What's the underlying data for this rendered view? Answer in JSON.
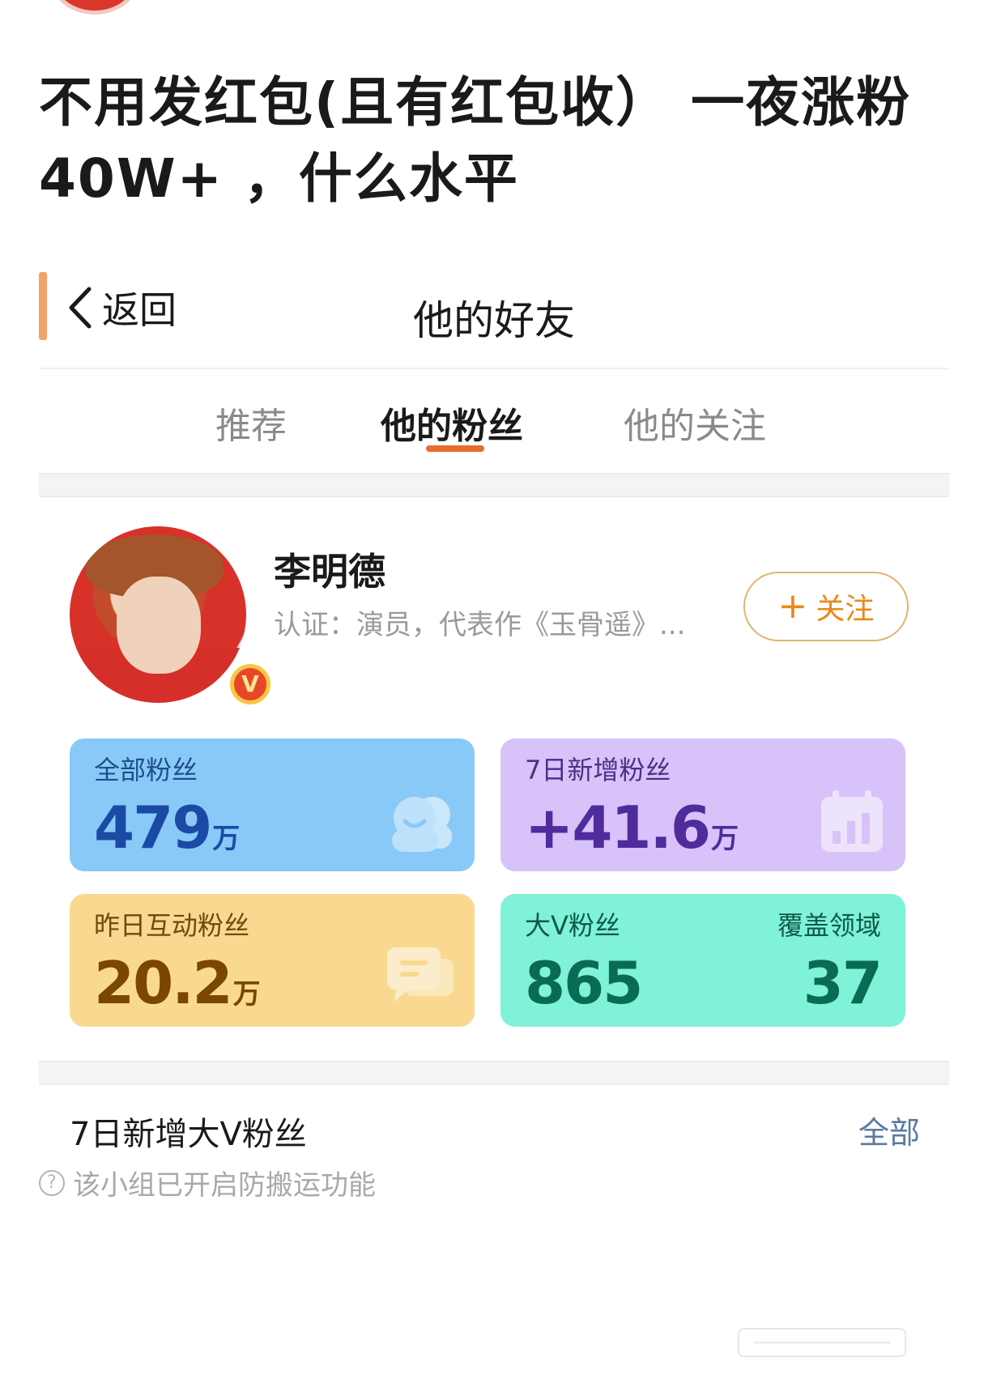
{
  "post": {
    "title": "不用发红包(且有红包收） 一夜涨粉40W+ ，什么水平"
  },
  "nav": {
    "back_label": "返回",
    "title": "他的好友"
  },
  "tabs": [
    {
      "label": "推荐",
      "active": false
    },
    {
      "label": "他的粉丝",
      "active": true
    },
    {
      "label": "他的关注",
      "active": false
    }
  ],
  "profile": {
    "name": "李明德",
    "certification": "认证：演员，代表作《玉骨遥》...",
    "verified_badge": "V",
    "follow_label": "关注",
    "follow_icon": "plus-icon"
  },
  "stats": {
    "total_fans": {
      "label": "全部粉丝",
      "value": "479",
      "unit": "万",
      "color": "#89c9f7",
      "icon": "users-icon"
    },
    "new_fans_7d": {
      "label": "7日新增粉丝",
      "value": "+41.6",
      "unit": "万",
      "color": "#d8c2fa",
      "icon": "calendar-chart-icon"
    },
    "interactive_fans": {
      "label": "昨日互动粉丝",
      "value": "20.2",
      "unit": "万",
      "color": "#f8d98f",
      "icon": "chat-icon"
    },
    "big_v_fans": {
      "label": "大V粉丝",
      "value": "865",
      "coverage_label": "覆盖领域",
      "coverage_value": "37",
      "color": "#7ff2d8"
    }
  },
  "section": {
    "title": "7日新增大V粉丝",
    "more_label": "全部"
  },
  "footer": {
    "note": "该小组已开启防搬运功能",
    "icon": "help-icon"
  }
}
